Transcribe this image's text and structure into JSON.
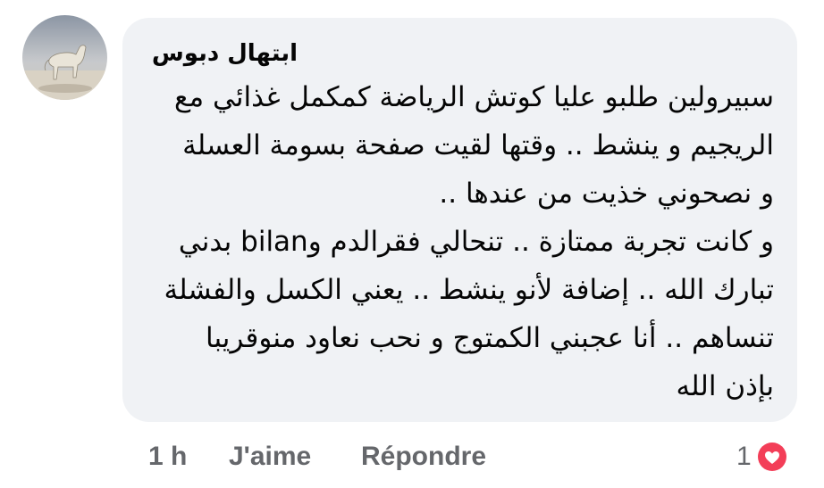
{
  "comment": {
    "author": "ابتهال دبوس",
    "text": "سبيرولين طلبو عليا كوتش الرياضة كمكمل غذائي مع\nالريجيم و ينشط .. وقتها لقيت صفحة بسومة العسلة\nو نصحوني خذيت من عندها ..\nو كانت تجربة ممتازة .. تنحالي فقرالدم وbilan بدني\nتبارك الله .. إضافة لأنو ينشط .. يعني الكسل والفشلة\nتنساهم .. أنا عجبني الكمتوج و نحب نعاود منوقريبا\nبإذن الله"
  },
  "actions": {
    "time": "1 h",
    "like_label": "J'aime",
    "reply_label": "Répondre"
  },
  "reactions": {
    "count": "1",
    "icon": "heart-icon",
    "color": "#f33e58"
  },
  "colors": {
    "bubble": "#f0f2f5",
    "text": "#050505",
    "meta": "#65676b"
  }
}
